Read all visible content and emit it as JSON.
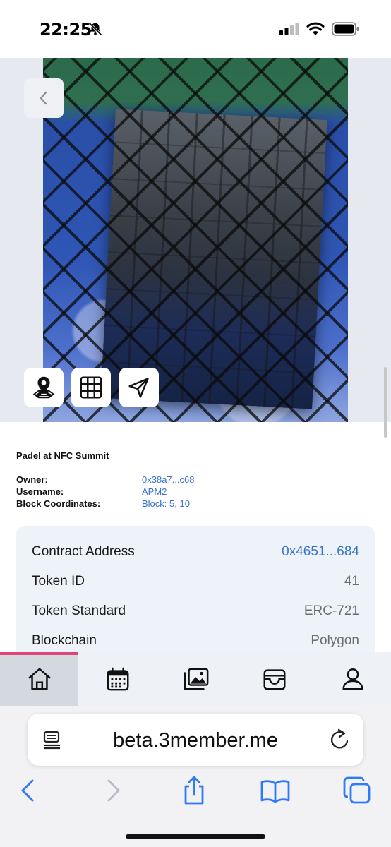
{
  "status_bar": {
    "time": "22:25",
    "icons": [
      "bell-slash-icon",
      "cellular-signal-icon",
      "wifi-icon",
      "battery-icon"
    ]
  },
  "hero": {
    "back_icon": "chevron-left-icon",
    "tools": [
      {
        "name": "map-pin-icon"
      },
      {
        "name": "grid-icon"
      },
      {
        "name": "send-icon"
      }
    ]
  },
  "nft": {
    "title": "Padel at NFC Summit",
    "meta": [
      {
        "label": "Owner:",
        "value": "0x38a7...c68"
      },
      {
        "label": "Username:",
        "value": "APM2"
      },
      {
        "label": "Block Coordinates:",
        "value": "Block: 5, 10"
      }
    ]
  },
  "details": [
    {
      "label": "Contract Address",
      "value": "0x4651...684"
    },
    {
      "label": "Token ID",
      "value": "41"
    },
    {
      "label": "Token Standard",
      "value": "ERC-721"
    },
    {
      "label": "Blockchain",
      "value": "Polygon"
    }
  ],
  "app_nav": {
    "items": [
      "home-icon",
      "calendar-icon",
      "gallery-icon",
      "wallet-icon",
      "user-icon"
    ],
    "active_index": 0,
    "accent_color": "#e0457a"
  },
  "browser": {
    "url": "beta.3member.me",
    "toolbar": [
      "back-icon",
      "forward-icon",
      "share-icon",
      "bookmarks-icon",
      "tabs-icon"
    ],
    "accent_color": "#2f7bf5"
  }
}
